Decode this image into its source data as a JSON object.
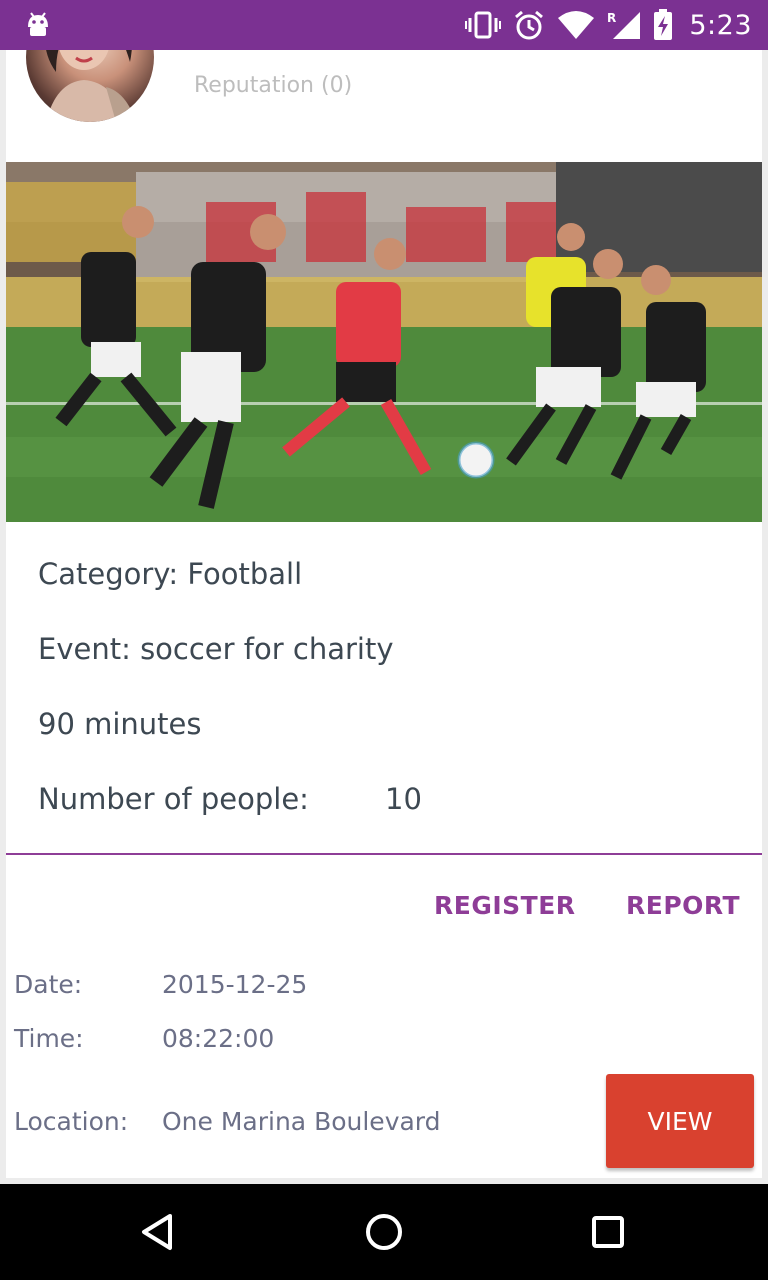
{
  "status_bar": {
    "time": "5:23",
    "icons": [
      "android-icon",
      "vibrate-icon",
      "alarm-icon",
      "wifi-icon",
      "signal-roaming-icon",
      "battery-charging-icon"
    ],
    "background": "#7b3192"
  },
  "profile": {
    "reputation": "Reputation (0)"
  },
  "event": {
    "category": "Category: Football",
    "event_name": "Event: soccer for charity",
    "duration": "90 minutes",
    "people_label": "Number of people:",
    "people_value": "10"
  },
  "actions": {
    "register": "REGISTER",
    "report": "REPORT",
    "view": "VIEW"
  },
  "details": {
    "date_label": "Date:",
    "date_value": "2015-12-25",
    "time_label": "Time:",
    "time_value": "08:22:00",
    "location_label": "Location:",
    "location_value": "One Marina Boulevard"
  },
  "colors": {
    "accent": "#8e3d97",
    "view_button": "#d9412f",
    "text_dark": "#3d4852",
    "text_muted": "#6b6f87"
  }
}
